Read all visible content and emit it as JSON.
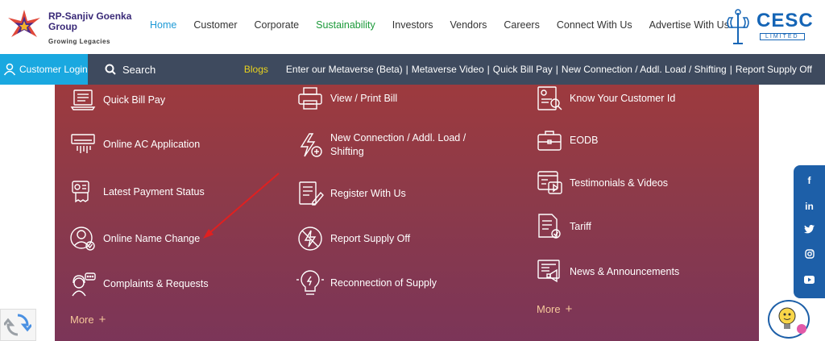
{
  "brand": {
    "name": "RP-Sanjiv Goenka Group",
    "tagline": "Growing Legacies"
  },
  "nav": {
    "items": [
      "Home",
      "Customer",
      "Corporate",
      "Sustainability",
      "Investors",
      "Vendors",
      "Careers",
      "Connect With Us",
      "Advertise With Us"
    ]
  },
  "cesc": {
    "name": "CESC",
    "sub": "LIMITED"
  },
  "bar": {
    "login": "Customer Login",
    "search": "Search",
    "blogs": "Blogs",
    "links": [
      "Enter our Metaverse (Beta)",
      "Metaverse Video",
      "Quick Bill Pay",
      "New Connection / Addl. Load / Shifting",
      "Report Supply Off"
    ]
  },
  "menu": {
    "col1": [
      "Quick Bill Pay",
      "Online AC Application",
      "Latest Payment Status",
      "Online Name Change",
      "Complaints & Requests"
    ],
    "col2": [
      "View / Print Bill",
      "New Connection / Addl. Load / Shifting",
      "Register With Us",
      "Report Supply Off",
      "Reconnection of Supply"
    ],
    "col3": [
      "Know Your Customer Id",
      "EODB",
      "Testimonials & Videos",
      "Tariff",
      "News & Announcements"
    ],
    "more": "More"
  },
  "social": [
    "f",
    "in",
    "twitter-icon",
    "instagram-icon",
    "youtube-icon"
  ],
  "colors": {
    "accent_blue": "#1aa8e0",
    "panel": "#8c3a4a",
    "bar": "#3e4a5e",
    "sustainability": "#1c9a3a",
    "blogs": "#e8d21e",
    "annotation_arrow": "#e02020"
  }
}
